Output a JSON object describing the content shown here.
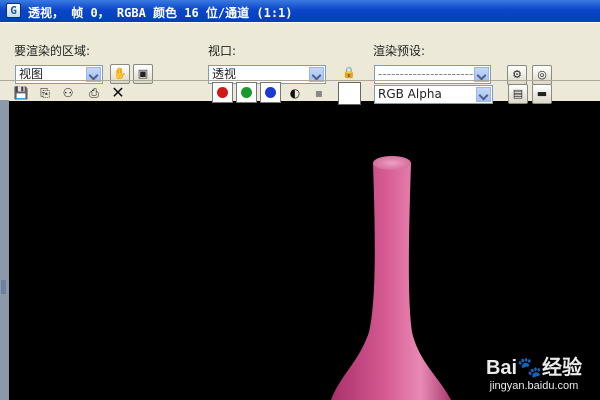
{
  "window": {
    "title": "透视， 帧 0， RGBA 颜色 16 位/通道 (1:1)",
    "icon": "app-icon"
  },
  "area": {
    "label": "要渲染的区域:",
    "value": "视图"
  },
  "viewport": {
    "label": "视口:",
    "value": "透视"
  },
  "preset": {
    "label": "渲染预设:",
    "value": "-----------------------"
  },
  "toolbar": {
    "channel_display": "RGB Alpha"
  },
  "colors": {
    "red": "#d01818",
    "green": "#1a9a2a",
    "blue": "#1a3ad0",
    "vase": "#d65a92",
    "background": "#000000"
  },
  "watermark": {
    "logo": "Bai🐾经验",
    "url": "jingyan.baidu.com"
  }
}
